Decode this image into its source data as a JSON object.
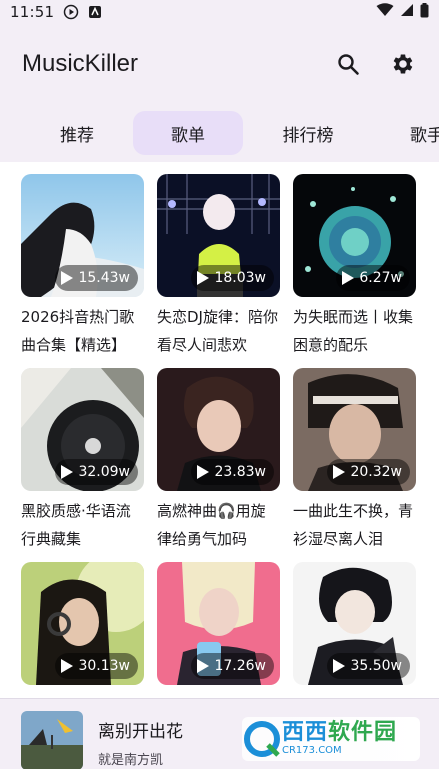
{
  "status_bar": {
    "time": "11:51"
  },
  "app_bar": {
    "title": "MusicKiller",
    "search_icon": "search-icon",
    "settings_icon": "gear-icon"
  },
  "tabs": [
    {
      "label": "推荐"
    },
    {
      "label": "歌单"
    },
    {
      "label": "排行榜"
    },
    {
      "label": "歌手"
    }
  ],
  "active_tab": "歌单",
  "playlists": [
    {
      "title": "2026抖音热门歌曲合集【精选】",
      "plays": "15.43w"
    },
    {
      "title": "失恋DJ旋律：陪你看尽人间悲欢",
      "plays": "18.03w"
    },
    {
      "title": "为失眠而选丨收集困意的配乐",
      "plays": "6.27w"
    },
    {
      "title": "黑胶质感·华语流行典藏集",
      "plays": "32.09w"
    },
    {
      "title": "高燃神曲🎧用旋律给勇气加码",
      "plays": "23.83w"
    },
    {
      "title": "一曲此生不换，青衫湿尽离人泪",
      "plays": "20.32w"
    },
    {
      "title": "",
      "plays": "30.13w"
    },
    {
      "title": "",
      "plays": "17.26w"
    },
    {
      "title": "",
      "plays": "35.50w"
    }
  ],
  "now_playing": {
    "song": "离别开出花",
    "artist": "就是南方凯"
  },
  "watermark": {
    "main": "西西",
    "main_alt": "软件园",
    "sub": "CR173.COM"
  },
  "colors": {
    "surface": "#f3eef6",
    "active_tab": "#e8def8",
    "text": "#1c1b1f"
  }
}
